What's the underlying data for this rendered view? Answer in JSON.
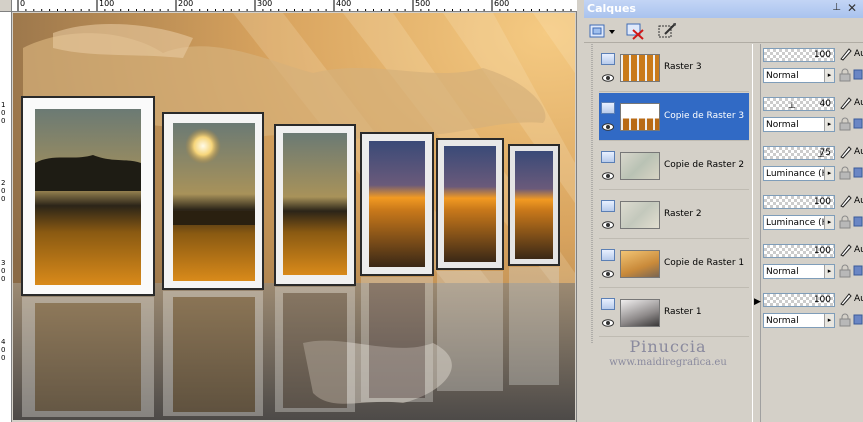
{
  "rulers": {
    "horizontal_ticks": [
      "0",
      "100",
      "200",
      "300",
      "400",
      "500",
      "600"
    ],
    "vertical_ticks": [
      "1",
      "0",
      "0",
      "2",
      "0",
      "0",
      "3",
      "0",
      "0",
      "4",
      "0",
      "0"
    ]
  },
  "panel": {
    "title": "Calques",
    "pin_icon": "pin-icon",
    "close_icon": "close-icon"
  },
  "toolbar": {
    "buttons": [
      "new-layer-icon",
      "delete-layer-icon",
      "layer-properties-icon"
    ]
  },
  "layers": [
    {
      "name": "Raster 3",
      "opacity": "100",
      "blend": "Normal",
      "selected": false,
      "thumb": "strip"
    },
    {
      "name": "Copie de Raster 3",
      "opacity": "40",
      "blend": "Normal",
      "selected": true,
      "thumb": "strip-reflect"
    },
    {
      "name": "Copie de Raster 2",
      "opacity": "75",
      "blend": "Luminance (H)",
      "selected": false,
      "thumb": "map"
    },
    {
      "name": "Raster 2",
      "opacity": "100",
      "blend": "Luminance (H)",
      "selected": false,
      "thumb": "map"
    },
    {
      "name": "Copie de Raster 1",
      "opacity": "100",
      "blend": "Normal",
      "selected": false,
      "thumb": "gold"
    },
    {
      "name": "Raster 1",
      "opacity": "100",
      "blend": "Normal",
      "selected": false,
      "thumb": "gray"
    }
  ],
  "props": {
    "brush_suffix": "Au"
  },
  "watermark": {
    "name": "Pinuccia",
    "url": "www.maidiregrafica.eu"
  },
  "colors": {
    "selection": "#316ac5",
    "panel_bg": "#d4d0c8",
    "titlebar": "#a9c3ee"
  }
}
